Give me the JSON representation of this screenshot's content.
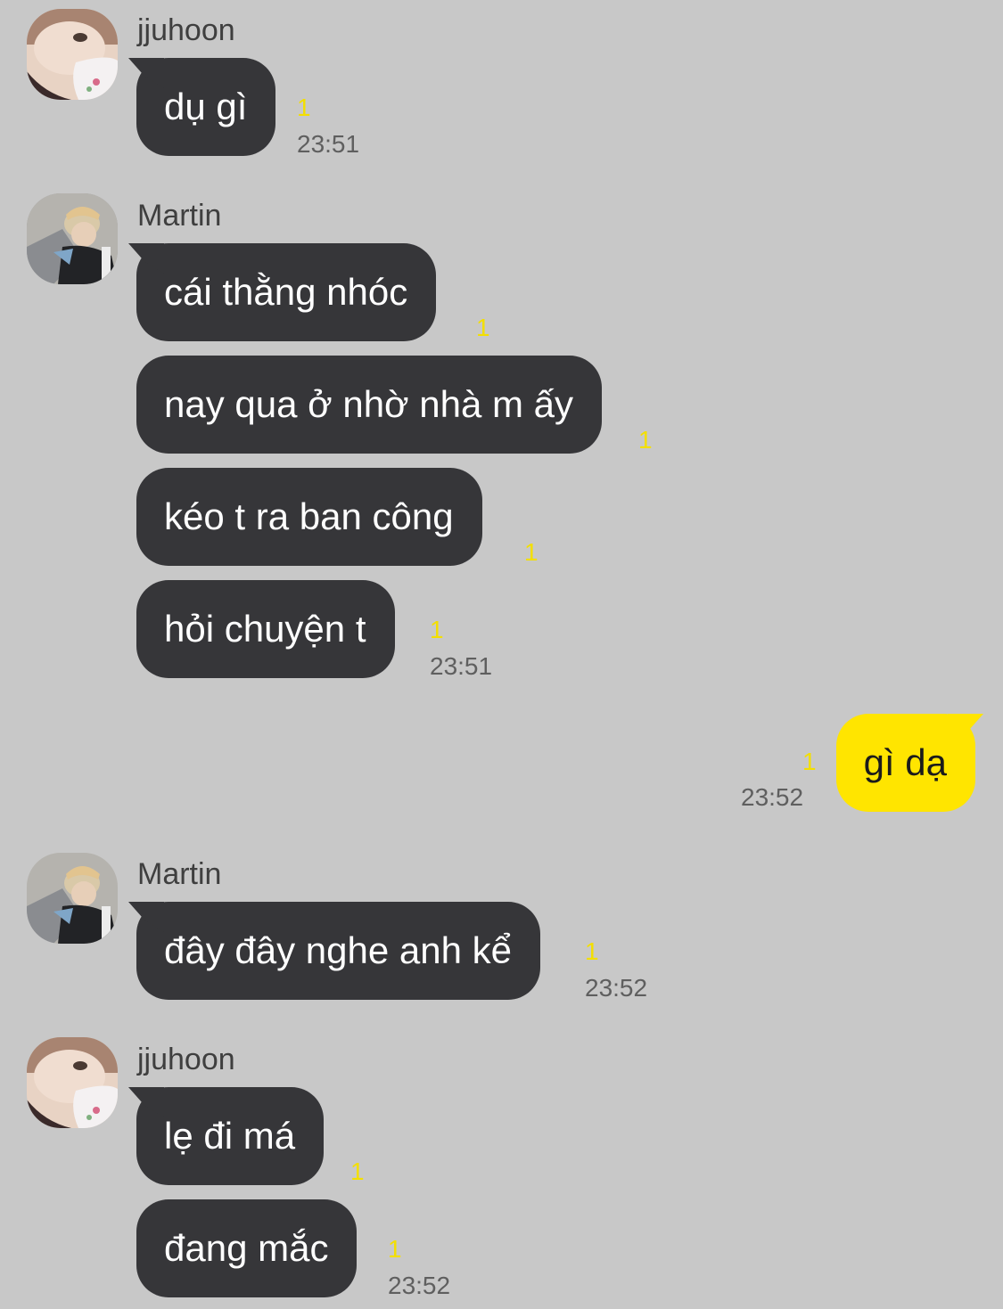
{
  "theme": {
    "background": "#c8c8c8",
    "incoming_bubble": "#363639",
    "outgoing_bubble": "#ffe500",
    "unread_color": "#f3df00"
  },
  "messages": [
    {
      "sender": "jjuhoon",
      "avatar_icon": "avatar-jjuhoon",
      "bubbles": [
        {
          "text": "dụ gì",
          "unread": "1"
        }
      ],
      "time": "23:51"
    },
    {
      "sender": "Martin",
      "avatar_icon": "avatar-martin",
      "bubbles": [
        {
          "text": "cái thằng nhóc",
          "unread": "1"
        },
        {
          "text": "nay qua ở nhờ nhà m ấy",
          "unread": "1"
        },
        {
          "text": "kéo t ra ban công",
          "unread": "1"
        },
        {
          "text": "hỏi chuyện t",
          "unread": "1"
        }
      ],
      "time": "23:51"
    },
    {
      "sender": "me",
      "bubbles": [
        {
          "text": "gì dạ",
          "unread": "1"
        }
      ],
      "time": "23:52"
    },
    {
      "sender": "Martin",
      "avatar_icon": "avatar-martin",
      "bubbles": [
        {
          "text": "đây đây nghe anh kể",
          "unread": "1"
        }
      ],
      "time": "23:52"
    },
    {
      "sender": "jjuhoon",
      "avatar_icon": "avatar-jjuhoon",
      "bubbles": [
        {
          "text": "lẹ đi má",
          "unread": "1"
        },
        {
          "text": "đang mắc",
          "unread": "1"
        }
      ],
      "time": "23:52"
    }
  ]
}
